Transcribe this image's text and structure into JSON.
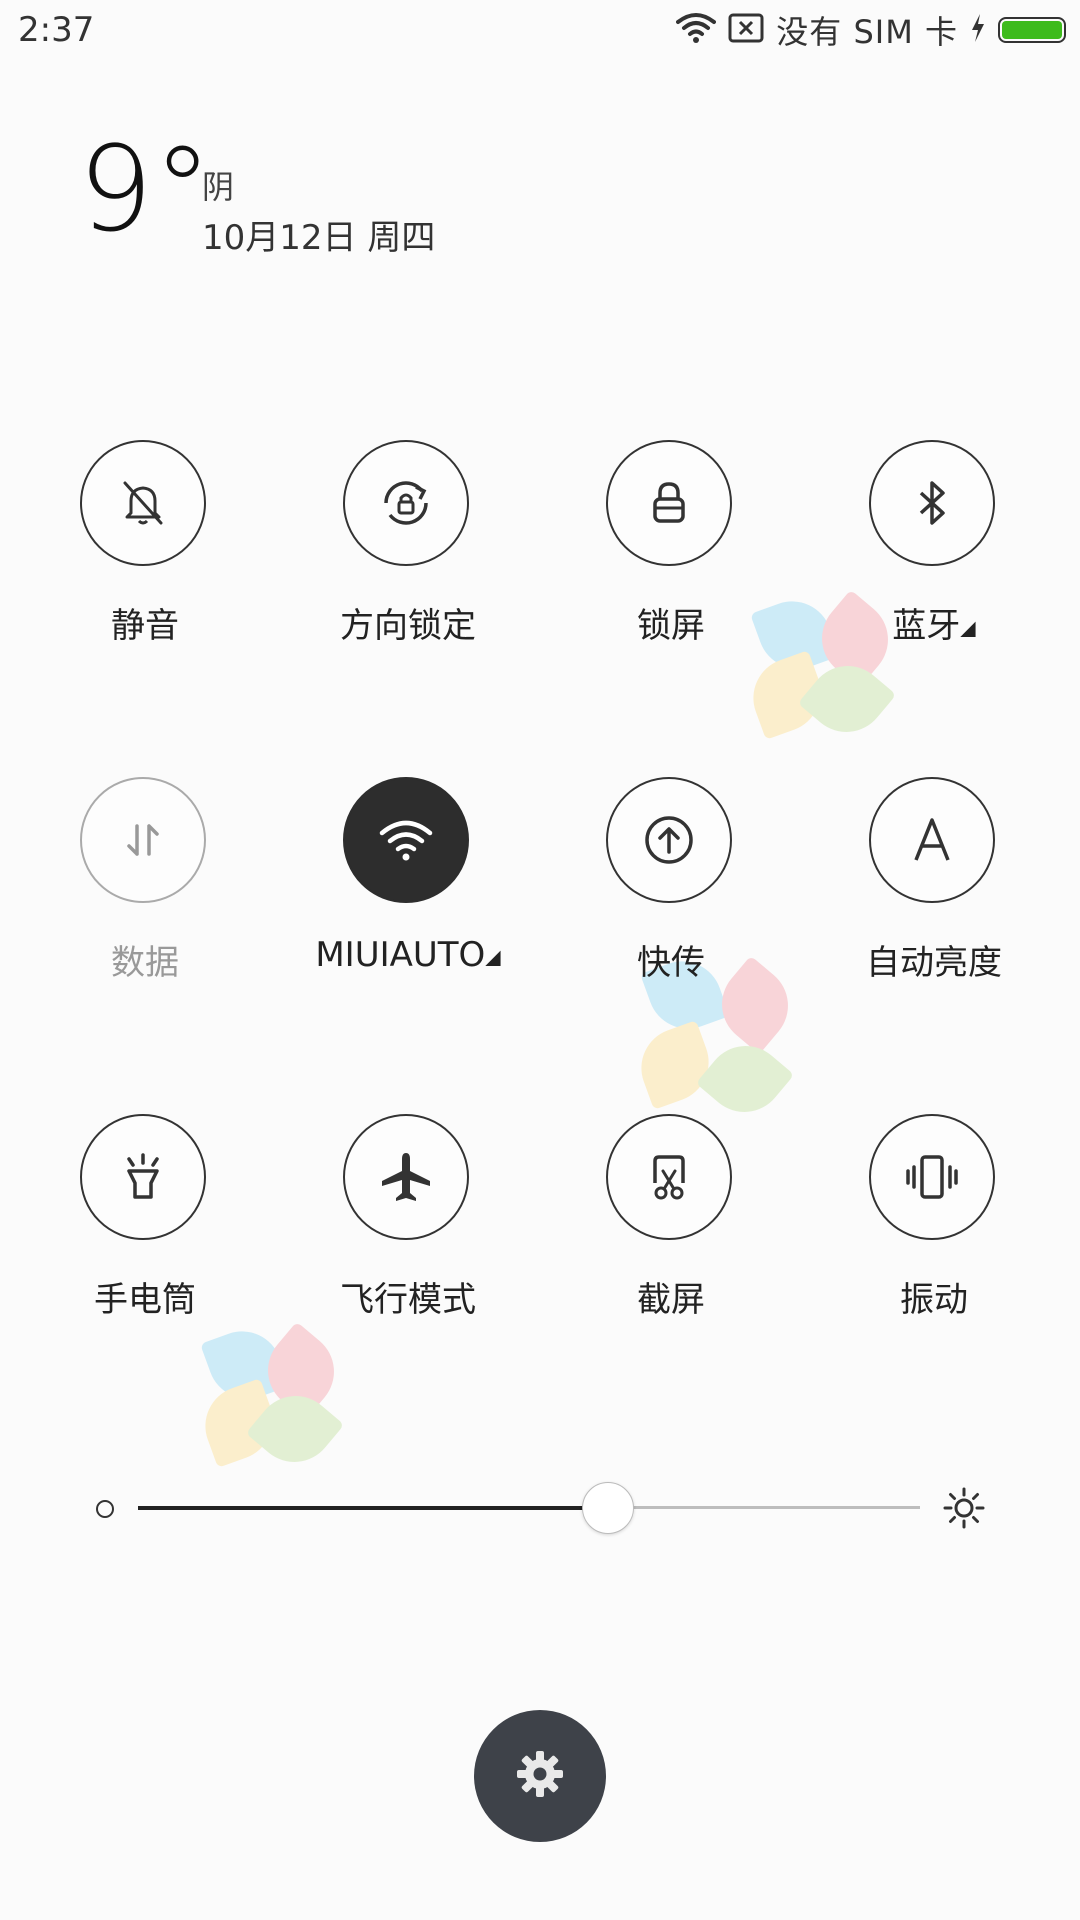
{
  "status_bar": {
    "time": "2:37",
    "carrier_text": "没有 SIM 卡",
    "icons": [
      "wifi-icon",
      "no-sim-icon",
      "charging-icon",
      "battery-icon"
    ],
    "battery_color": "#3dbb1c"
  },
  "weather": {
    "temperature": "9°",
    "condition": "阴",
    "date": "10月12日 周四"
  },
  "toggles": [
    {
      "label": "静音",
      "icon": "bell-off-icon",
      "state": "off"
    },
    {
      "label": "方向锁定",
      "icon": "rotation-lock-icon",
      "state": "off"
    },
    {
      "label": "锁屏",
      "icon": "lock-icon",
      "state": "off"
    },
    {
      "label": "蓝牙",
      "icon": "bluetooth-icon",
      "state": "off",
      "has_arrow": true
    },
    {
      "label": "数据",
      "icon": "data-icon",
      "state": "disabled"
    },
    {
      "label": "MIUIAUTO",
      "icon": "wifi-icon",
      "state": "on",
      "has_arrow": true
    },
    {
      "label": "快传",
      "icon": "upload-icon",
      "state": "off"
    },
    {
      "label": "自动亮度",
      "icon": "auto-brightness-icon",
      "state": "off"
    },
    {
      "label": "手电筒",
      "icon": "flashlight-icon",
      "state": "off"
    },
    {
      "label": "飞行模式",
      "icon": "airplane-icon",
      "state": "off"
    },
    {
      "label": "截屏",
      "icon": "screenshot-icon",
      "state": "off"
    },
    {
      "label": "振动",
      "icon": "vibrate-icon",
      "state": "off"
    }
  ],
  "brightness": {
    "level": 0.6,
    "low_icon": "brightness-low-icon",
    "high_icon": "brightness-high-icon"
  },
  "settings_button": {
    "icon": "gear-icon"
  },
  "colors": {
    "active_toggle": "#2d2d2d",
    "settings_fab": "#3e4249"
  }
}
